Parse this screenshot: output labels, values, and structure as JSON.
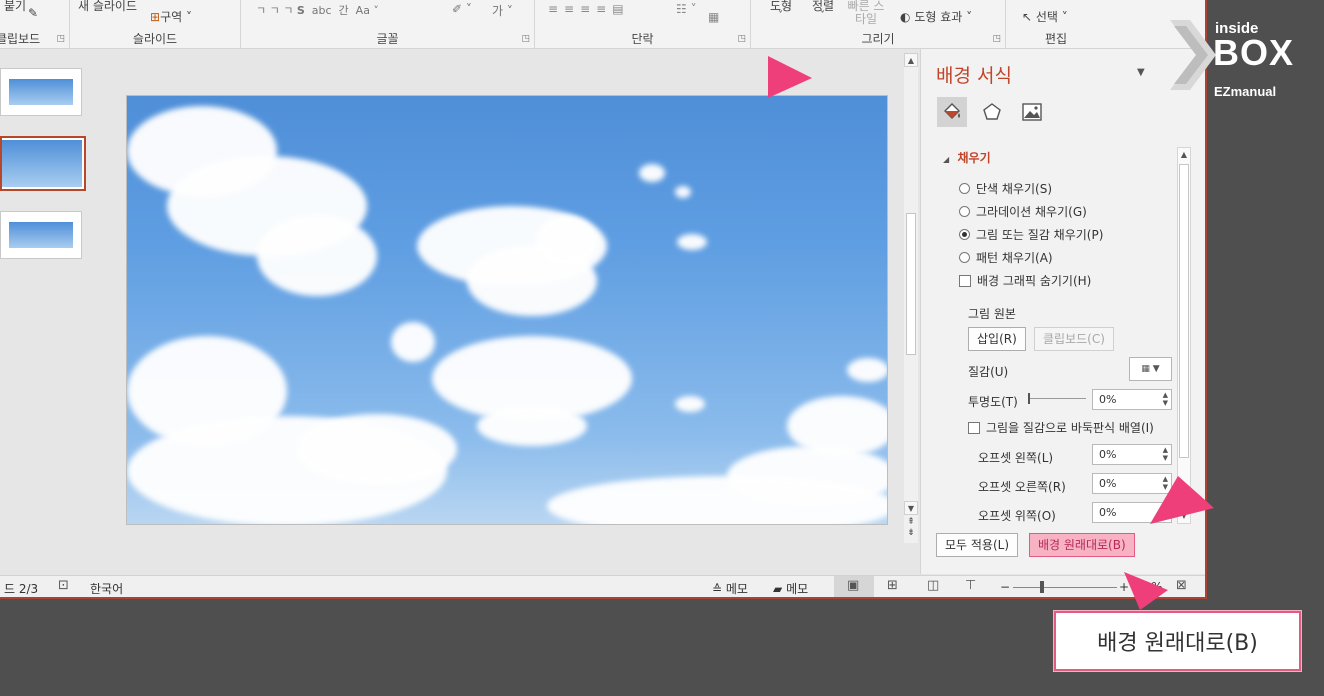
{
  "ribbon": {
    "top_text": {
      "item1": "붙기",
      "item2": "새 슬라이드",
      "item3": "구역",
      "item4": "도형",
      "item5": "정렬",
      "item6": "빠른 스타일",
      "item7": "도형 효과",
      "item8": "선택"
    },
    "groups": {
      "clipboard": "클립보드",
      "slides": "슬라이드",
      "font": "글꼴",
      "paragraph": "단락",
      "drawing": "그리기",
      "editing": "편집"
    }
  },
  "pane": {
    "title": "배경 서식",
    "section": "채우기",
    "fill_options": [
      "단색 채우기(S)",
      "그라데이션 채우기(G)",
      "그림 또는 질감 채우기(P)",
      "패턴 채우기(A)"
    ],
    "hide_graphics": "배경 그래픽 숨기기(H)",
    "picture_source": "그림 원본",
    "insert_button": "삽입(R)",
    "clipboard_button": "클립보드(C)",
    "texture_label": "질감(U)",
    "transparency_label": "투명도(T)",
    "transparency_value": "0%",
    "tile_label": "그림을 질감으로 바둑판식 배열(I)",
    "offset_left_label": "오프셋 왼쪽(L)",
    "offset_left_value": "0%",
    "offset_right_label": "오프셋 오른쪽(R)",
    "offset_right_value": "0%",
    "offset_top_label": "오프셋 위쪽(O)",
    "offset_top_value": "0%",
    "apply_all_button": "모두 적용(L)",
    "reset_button": "배경 원래대로(B)"
  },
  "status": {
    "slide_indicator": "드 2/3",
    "language": "한국어",
    "notes": "메모",
    "comments": "메모",
    "zoom": "60%"
  },
  "logo": {
    "line1": "inside",
    "line2": "BOX",
    "line3": "EZmanual"
  },
  "callout": {
    "text": "배경 원래대로(B)"
  },
  "colors": {
    "accent": "#c0462b",
    "highlight": "#e35a82",
    "highlight_fill": "#f7b3c4"
  }
}
